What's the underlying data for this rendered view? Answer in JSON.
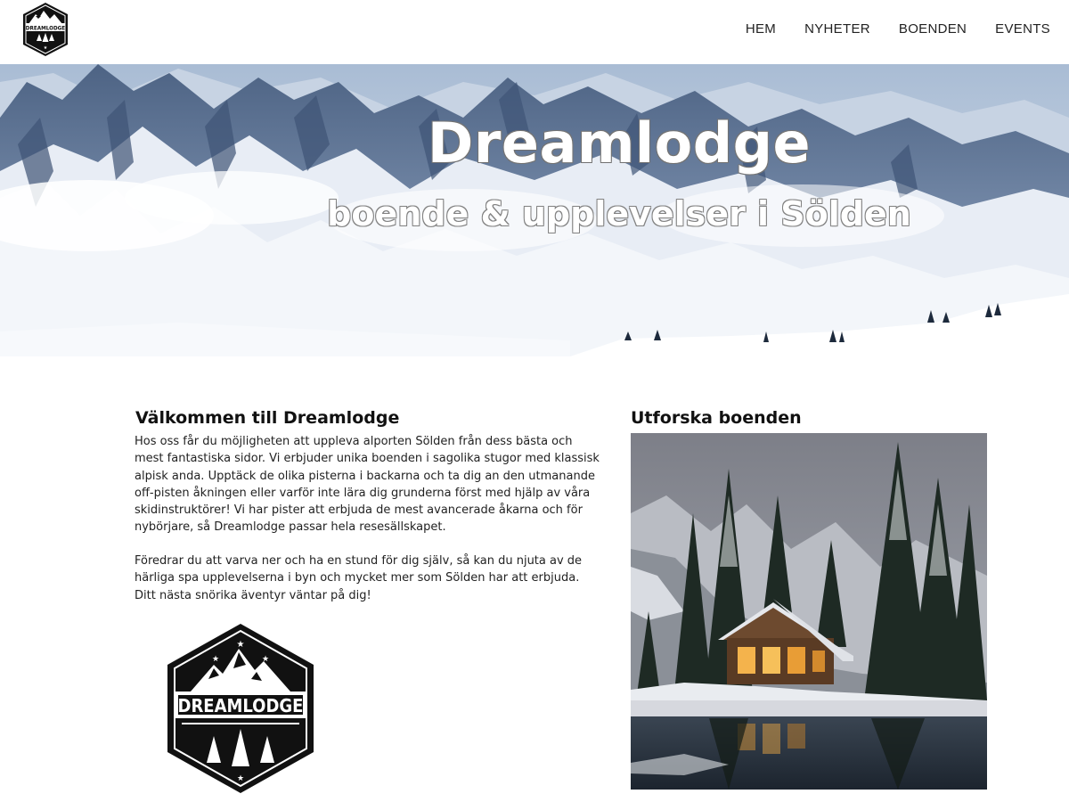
{
  "header": {
    "logo_text": "DREAMLODGE",
    "nav": [
      {
        "label": "HEM"
      },
      {
        "label": "NYHETER"
      },
      {
        "label": "BOENDEN"
      },
      {
        "label": "EVENTS"
      }
    ]
  },
  "hero": {
    "title": "Dreamlodge",
    "subtitle": "boende & upplevelser i Sölden"
  },
  "welcome": {
    "heading": "Välkommen till Dreamlodge",
    "paragraph1": "Hos oss får du möjligheten att uppleva alporten Sölden från dess bästa och mest fantastiska sidor. Vi erbjuder unika boenden i sagolika stugor med klassisk alpisk anda. Upptäck de olika pisterna i backarna och ta dig an den utmanande off-pisten åkningen eller varför inte lära dig grunderna först med hjälp av våra skidinstruktörer! Vi har pister att erbjuda de mest avancerade åkarna och för nybörjare, så Dreamlodge passar hela resesällskapet.",
    "paragraph2": "Föredrar du att varva ner och ha en stund för dig själv, så kan du njuta av de härliga spa upplevelserna i byn och mycket mer som Sölden har att erbjuda. Ditt nästa snörika äventyr väntar på dig!",
    "logo_text": "DREAMLODGE"
  },
  "explore": {
    "heading": "Utforska boenden"
  }
}
